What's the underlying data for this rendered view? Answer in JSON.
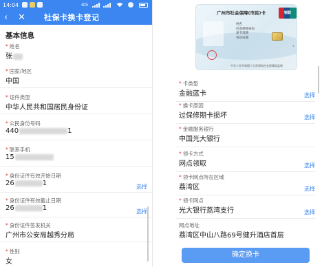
{
  "status_bar": {
    "time": "14:04",
    "network": "4G"
  },
  "nav": {
    "back_glyph": "‹",
    "close_glyph": "✕",
    "title": "社保卡换卡登记"
  },
  "section_title": "基本信息",
  "left_fields": [
    {
      "label": "姓名",
      "value": "张",
      "required": false
    },
    {
      "label": "国家/地区",
      "value": "中国",
      "required": true
    },
    {
      "label": "证件类型",
      "value": "中华人民共和国居民身份证",
      "required": true
    },
    {
      "label": "公民身份号码",
      "value_prefix": "440",
      "value_suffix": "1",
      "required": true
    },
    {
      "label": "联系手机",
      "value_prefix": "15",
      "value_suffix": "",
      "required": true
    },
    {
      "label": "身份证件有效开始日期",
      "value_prefix": "26",
      "value_suffix": "1",
      "required": true,
      "select": "选择"
    },
    {
      "label": "身份证件有效截止日期",
      "value_prefix": "26",
      "value_suffix": "1",
      "required": true,
      "select": "选择"
    },
    {
      "label": "身份证件签发机关",
      "value": "广州市公安局越秀分局",
      "required": true
    },
    {
      "label": "性别",
      "value": "女",
      "required": true
    }
  ],
  "card_image": {
    "title": "广州市社会保障(市民)卡",
    "brand": "银联",
    "rows": [
      "姓名",
      "社会保障号码",
      "发卡日期",
      "有效日期"
    ],
    "bottom_note": "中华人民共和国人力资源和社会保障部监制"
  },
  "right_fields": [
    {
      "label": "卡类型",
      "value": "金融蓝卡",
      "required": true,
      "select": "选择"
    },
    {
      "label": "换卡原因",
      "value": "过保修期卡损坏",
      "required": true,
      "select": "选择"
    },
    {
      "label": "金融服务银行",
      "value": "中国光大银行",
      "required": true,
      "select": ""
    },
    {
      "label": "领卡方式",
      "value": "网点领取",
      "required": true,
      "select": "选择"
    },
    {
      "label": "领卡网点所在区域",
      "value": "荔湾区",
      "required": true,
      "select": "选择"
    },
    {
      "label": "领卡网点",
      "value": "光大银行荔湾支行",
      "required": true,
      "select": "选择"
    },
    {
      "label": "网点地址",
      "value": "荔湾区中山八路69号健升酒店首层",
      "required": false,
      "select": ""
    }
  ],
  "confirm_button": "确定换卡",
  "colors": {
    "primary": "#3b86f0",
    "required": "#e53935",
    "button": "#5a9bf3"
  }
}
